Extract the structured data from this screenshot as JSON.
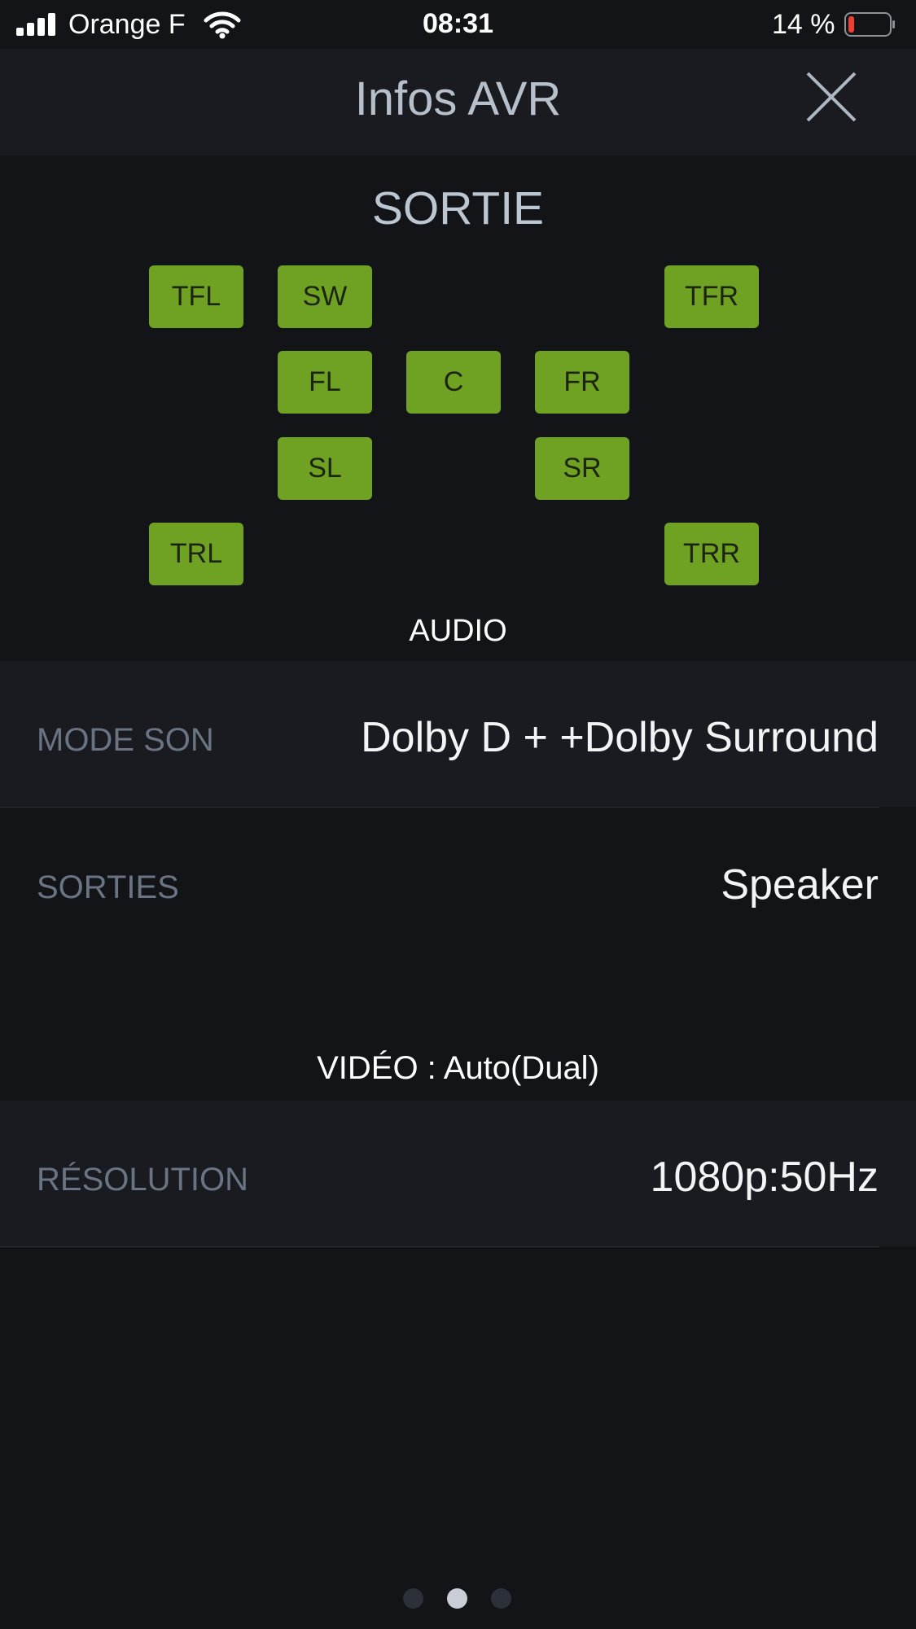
{
  "status_bar": {
    "carrier": "Orange F",
    "time": "08:31",
    "battery_percent": "14 %",
    "battery_level": 0.14,
    "icons": [
      "signal-icon",
      "wifi-icon",
      "battery-icon"
    ]
  },
  "nav": {
    "title": "Infos AVR",
    "close_icon": "close-icon"
  },
  "output": {
    "title": "SORTIE",
    "speakers": [
      "TFL",
      "SW",
      "TFR",
      "FL",
      "C",
      "FR",
      "SL",
      "SR",
      "TRL",
      "TRR"
    ],
    "speaker_color": "#6fa223",
    "audio_label": "AUDIO"
  },
  "audio": {
    "mode_label": "MODE SON",
    "mode_value": "Dolby D + +Dolby Surround",
    "outputs_label": "SORTIES",
    "outputs_value": "Speaker"
  },
  "video": {
    "label": "VIDÉO : Auto(Dual)",
    "resolution_label": "RÉSOLUTION",
    "resolution_value": "1080p:50Hz"
  },
  "pager": {
    "page_count": 3,
    "active_index": 1
  }
}
